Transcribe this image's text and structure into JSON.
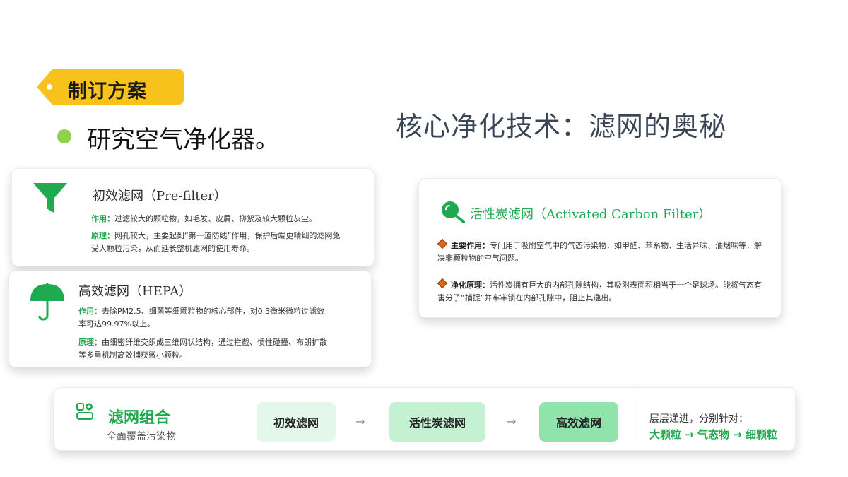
{
  "tag": {
    "label": "制订方案"
  },
  "intro": "研究空气净化器。",
  "main_title": "核心净化技术：滤网的奥秘",
  "prefilter": {
    "title": "初效滤网（Pre-filter）",
    "use_label": "作用：",
    "use_text": "过滤较大的颗粒物，如毛发、皮屑、柳絮及较大颗粒灰尘。",
    "principle_label": "原理：",
    "principle_text": "网孔较大，主要起到“第一道防线”作用，保护后端更精细的滤网免受大颗粒污染，从而延长整机滤网的使用寿命。"
  },
  "hepa": {
    "title": "高效滤网（HEPA）",
    "use_label": "作用：",
    "use_text": "去除PM2.5、细菌等细颗粒物的核心部件，对0.3微米微粒过滤效率可达99.97%以上。",
    "principle_label": "原理：",
    "principle_text": "由细密纤维交织成三维网状结构，通过拦截、惯性碰撞、布朗扩散等多重机制高效捕获微小颗粒。"
  },
  "activated_carbon": {
    "title": "活性炭滤网（Activated Carbon Filter）",
    "use_label": "主要作用：",
    "use_text": "专门用于吸附空气中的气态污染物，如甲醛、苯系物、生活异味、油烟味等，解决非颗粒物的空气问题。",
    "principle_label": "净化原理：",
    "principle_text": "活性炭拥有巨大的内部孔隙结构，其吸附表面积相当于一个足球场。能将气态有害分子“捕捉”并牢牢锁在内部孔隙中，阻止其逸出。"
  },
  "combo": {
    "title": "滤网组合",
    "subtitle": "全面覆盖污染物",
    "steps": [
      "初效滤网",
      "活性炭滤网",
      "高效滤网"
    ],
    "arrow": "→",
    "summary_line1": "层层递进，分别针对：",
    "summary_line2": "大颗粒 → 气态物 → 细颗粒"
  },
  "colors": {
    "accent_green": "#1faa4f",
    "tag_yellow": "#f7c21c",
    "bullet_green": "#8dd24a",
    "diamond_orange": "#e0661c"
  },
  "icons": [
    "funnel-icon",
    "umbrella-icon",
    "magnifier-icon",
    "filter-stack-icon"
  ]
}
